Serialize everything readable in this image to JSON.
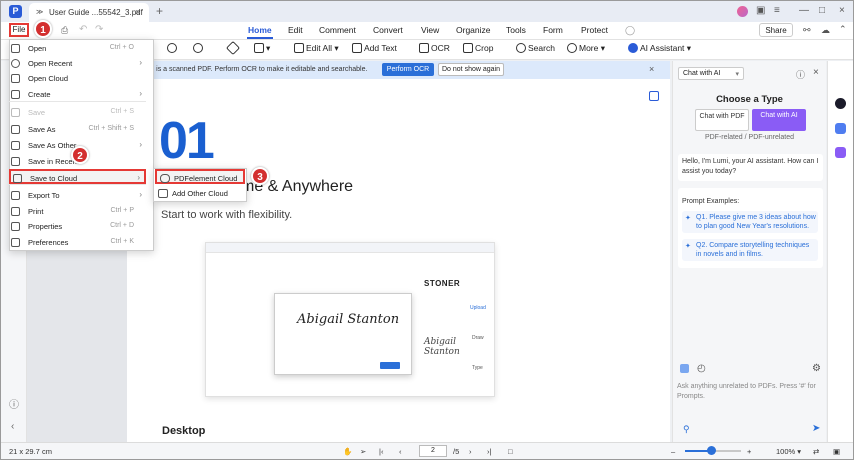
{
  "titlebar": {
    "tab_title": "User Guide ...55542_3.pdf"
  },
  "menubar": {
    "file": "File",
    "items": [
      "Home",
      "Edit",
      "Comment",
      "Convert",
      "View",
      "Organize",
      "Tools",
      "Form",
      "Protect"
    ],
    "share": "Share"
  },
  "toolbar": {
    "edit_all": "Edit All",
    "add_text": "Add Text",
    "ocr": "OCR",
    "crop": "Crop",
    "search": "Search",
    "more": "More",
    "ai_assistant": "AI Assistant"
  },
  "ocr_bar": {
    "message": "This is a scanned PDF. Perform OCR to make it editable and searchable.",
    "perform": "Perform OCR",
    "dont_show": "Do not show again"
  },
  "file_menu": {
    "items": [
      {
        "label": "Open",
        "shortcut": "Ctrl + O",
        "arrow": false,
        "disabled": false
      },
      {
        "label": "Open Recent",
        "shortcut": "",
        "arrow": true,
        "disabled": false
      },
      {
        "label": "Open Cloud",
        "shortcut": "",
        "arrow": false,
        "disabled": false
      },
      {
        "label": "Create",
        "shortcut": "",
        "arrow": true,
        "disabled": false
      },
      {
        "label": "Save",
        "shortcut": "Ctrl + S",
        "arrow": false,
        "disabled": true
      },
      {
        "label": "Save As",
        "shortcut": "Ctrl + Shift + S",
        "arrow": false,
        "disabled": false
      },
      {
        "label": "Save As Other",
        "shortcut": "",
        "arrow": true,
        "disabled": false
      },
      {
        "label": "Save in Recent",
        "shortcut": "",
        "arrow": false,
        "disabled": false
      },
      {
        "label": "Save to Cloud",
        "shortcut": "",
        "arrow": true,
        "disabled": false
      },
      {
        "label": "Export To",
        "shortcut": "",
        "arrow": true,
        "disabled": false
      },
      {
        "label": "Print",
        "shortcut": "Ctrl + P",
        "arrow": false,
        "disabled": false
      },
      {
        "label": "Properties",
        "shortcut": "Ctrl + D",
        "arrow": false,
        "disabled": false
      },
      {
        "label": "Preferences",
        "shortcut": "Ctrl + K",
        "arrow": false,
        "disabled": false
      }
    ],
    "submenu": [
      "PDFelement Cloud",
      "Add Other Cloud"
    ]
  },
  "steps": [
    "1",
    "2",
    "3"
  ],
  "document": {
    "number": "01",
    "heading": "Anytime & Anywhere",
    "heading_visible": "me & Anywhere",
    "subheading": "Start to work with flexibility.",
    "section": "Desktop",
    "embedded": {
      "brand": "STONER",
      "signature": "Abigail Stanton",
      "panel": [
        "Upload",
        "Draw",
        "Type"
      ]
    }
  },
  "ai_panel": {
    "mode_select": "Chat with AI",
    "choose_title": "Choose a Type",
    "options": [
      "Chat with PDF",
      "Chat with AI"
    ],
    "options_sub": "PDF-related / PDF-unrelated",
    "greeting": "Hello, I'm Lumi, your AI assistant. How can I assist you today?",
    "prompt_title": "Prompt Examples:",
    "prompts": [
      "Q1. Please give me 3 ideas about how to plan good New Year's resolutions.",
      "Q2. Compare storytelling techniques in novels and in films."
    ],
    "input_placeholder": "Ask anything unrelated to PDFs. Press '#' for Prompts."
  },
  "statusbar": {
    "dimensions": "21 x 29.7 cm",
    "page_current": "2",
    "page_total": "/5",
    "zoom": "100%",
    "zoom_level": 0.46
  },
  "colors": {
    "accent": "#2a5bd7",
    "highlight": "#e53935",
    "ai_purple": "#8a5cf5"
  }
}
